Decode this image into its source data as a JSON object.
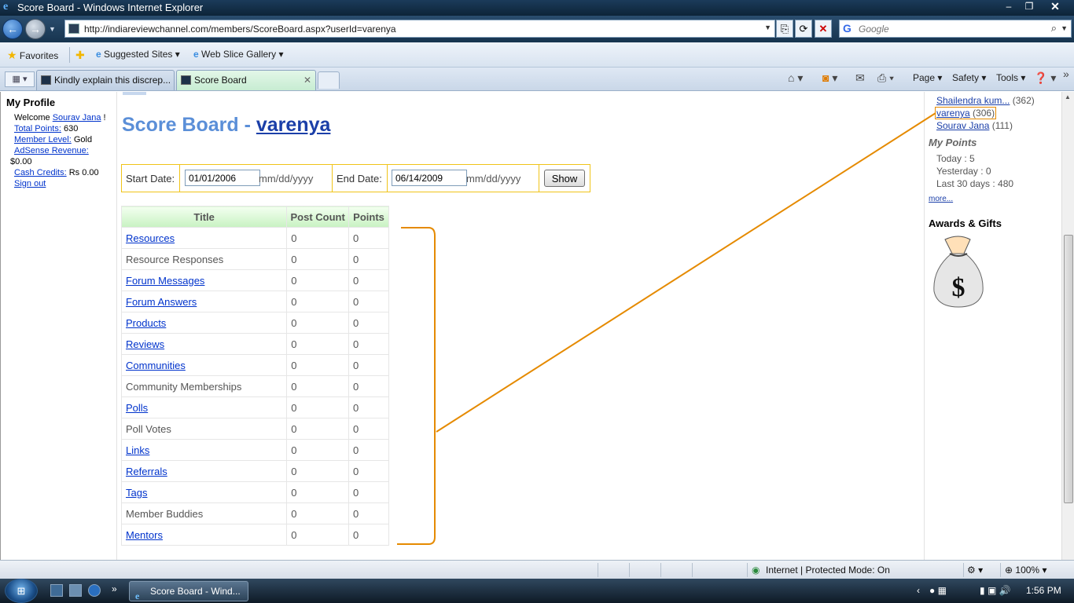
{
  "window": {
    "title": "Score Board - Windows Internet Explorer",
    "min": "‒",
    "max": "❐",
    "close": "✕"
  },
  "nav": {
    "back": "←",
    "forward": "→",
    "url": "http://indiareviewchannel.com/members/ScoreBoard.aspx?userId=varenya",
    "search_placeholder": "Google"
  },
  "favorites": {
    "favorites_label": "Favorites",
    "suggested_label": "Suggested Sites",
    "webslice_label": "Web Slice Gallery"
  },
  "tabs": [
    {
      "label": "Kindly explain this discrep..."
    },
    {
      "label": "Score Board"
    }
  ],
  "commandbar": {
    "page": "Page",
    "safety": "Safety",
    "tools": "Tools"
  },
  "left_panel": {
    "heading": "My Profile",
    "welcome_prefix": "Welcome",
    "user_name": "Sourav Jana",
    "welcome_suffix": "!",
    "total_points_label": "Total Points:",
    "total_points_value": "630",
    "member_level_label": "Member Level:",
    "member_level_value": "Gold",
    "adsense_label": "AdSense Revenue:",
    "adsense_value": "$0.00",
    "cash_credits_label": "Cash Credits:",
    "cash_credits_value": "Rs 0.00",
    "signout": "Sign out"
  },
  "main": {
    "title_prefix": "Score Board - ",
    "title_user": "varenya",
    "filter": {
      "start_label": "Start Date:",
      "start_value": "01/01/2006",
      "start_format": "mm/dd/yyyy",
      "end_label": "End Date:",
      "end_value": "06/14/2009",
      "end_format": "mm/dd/yyyy",
      "show_button": "Show"
    },
    "table": {
      "headers": [
        "Title",
        "Post Count",
        "Points"
      ],
      "rows": [
        {
          "title": "Resources",
          "link": true,
          "count": "0",
          "points": "0"
        },
        {
          "title": "Resource Responses",
          "link": false,
          "count": "0",
          "points": "0"
        },
        {
          "title": "Forum Messages",
          "link": true,
          "count": "0",
          "points": "0"
        },
        {
          "title": "Forum Answers",
          "link": true,
          "count": "0",
          "points": "0"
        },
        {
          "title": "Products",
          "link": true,
          "count": "0",
          "points": "0"
        },
        {
          "title": "Reviews",
          "link": true,
          "count": "0",
          "points": "0"
        },
        {
          "title": "Communities",
          "link": true,
          "count": "0",
          "points": "0"
        },
        {
          "title": "Community Memberships",
          "link": false,
          "count": "0",
          "points": "0"
        },
        {
          "title": "Polls",
          "link": true,
          "count": "0",
          "points": "0"
        },
        {
          "title": "Poll Votes",
          "link": false,
          "count": "0",
          "points": "0"
        },
        {
          "title": "Links",
          "link": true,
          "count": "0",
          "points": "0"
        },
        {
          "title": "Referrals",
          "link": true,
          "count": "0",
          "points": "0"
        },
        {
          "title": "Tags",
          "link": true,
          "count": "0",
          "points": "0"
        },
        {
          "title": "Member Buddies",
          "link": false,
          "count": "0",
          "points": "0"
        },
        {
          "title": "Mentors",
          "link": true,
          "count": "0",
          "points": "0"
        }
      ]
    }
  },
  "right_panel": {
    "leaders": [
      {
        "name": "Shailendra kum...",
        "score": "(362)"
      },
      {
        "name": "varenya",
        "score": "(306)"
      },
      {
        "name": "Sourav Jana",
        "score": "(111)"
      }
    ],
    "my_points_heading": "My Points",
    "today": "Today : 5",
    "yesterday": "Yesterday : 0",
    "last30": "Last 30 days : 480",
    "more": "more...",
    "awards_heading": "Awards & Gifts"
  },
  "status": {
    "zone": "Internet | Protected Mode: On",
    "zoom": "100%"
  },
  "taskbar": {
    "window_button": "Score Board - Wind...",
    "time": "1:56 PM"
  },
  "colors": {
    "annotation": "#e58a00",
    "link": "#0033cc",
    "title_blue": "#5b8fd8"
  }
}
